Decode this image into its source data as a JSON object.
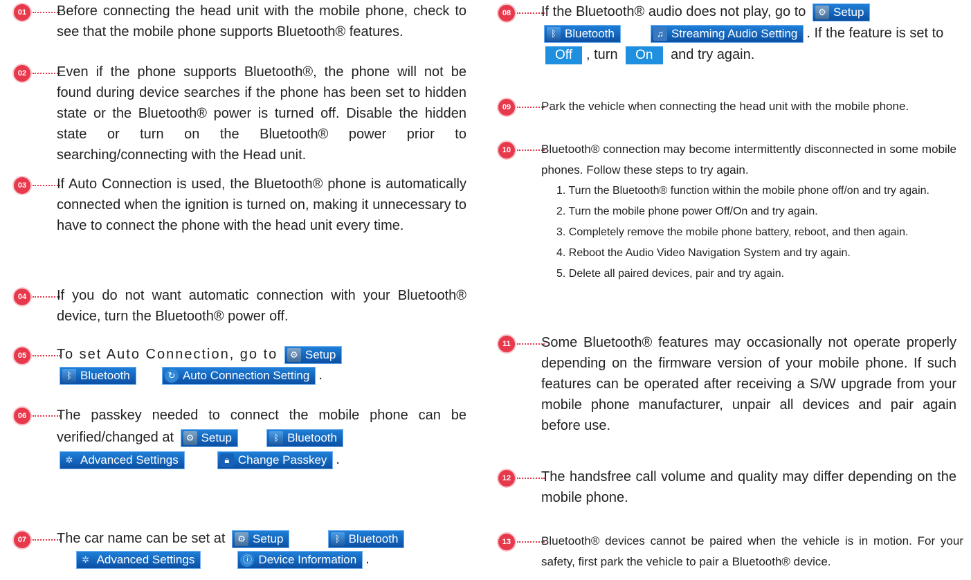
{
  "items": [
    {
      "num": "01",
      "text": "Before connecting the head unit with the mobile phone, check to see that the mobile phone supports Bluetooth® features."
    },
    {
      "num": "02",
      "text": "Even if the phone supports Bluetooth®, the phone will not be found during device searches if the phone has been set to hidden state or the Bluetooth® power is turned off. Disable the hidden state or turn on the Bluetooth® power prior to searching/connecting with the Head unit."
    },
    {
      "num": "03",
      "text": "If Auto Connection is used, the Bluetooth® phone is automatically connected when the ignition is turned on, making it unnecessary to have to connect the phone with the head unit every time."
    },
    {
      "num": "04",
      "text": "If you do not want automatic connection with your Bluetooth® device, turn the Bluetooth® power off."
    },
    {
      "num": "05",
      "text": "To set Auto Connection, go to",
      "buttons": [
        "Setup",
        "Bluetooth",
        "Auto Connection Setting"
      ],
      "end": "."
    },
    {
      "num": "06",
      "text": "The passkey needed to connect the mobile phone can be verified/changed at",
      "buttons": [
        "Setup",
        "Bluetooth",
        "Advanced Settings",
        "Change Passkey"
      ],
      "end": "."
    },
    {
      "num": "07",
      "text": "The car name can be set at",
      "buttons": [
        "Setup",
        "Bluetooth",
        "Advanced Settings",
        "Device Information"
      ],
      "end": "."
    },
    {
      "num": "08",
      "text_a": "If the Bluetooth® audio does not play, go to",
      "buttons": [
        "Setup",
        "Bluetooth",
        "Streaming Audio Setting"
      ],
      "text_b": ". If the feature is set to",
      "chip_off": "Off",
      "text_c": ", turn",
      "chip_on": "On",
      "text_d": "and try again."
    },
    {
      "num": "09",
      "text": "Park the vehicle when connecting the head unit with the mobile phone."
    },
    {
      "num": "10",
      "text": "Bluetooth® connection may become intermittently disconnected in some mobile phones. Follow these steps to try again.",
      "steps": [
        "1. Turn the Bluetooth® function within the mobile phone off/on and try again.",
        "2. Turn the mobile phone power Off/On and try again.",
        "3. Completely remove the mobile phone battery, reboot, and then again.",
        "4. Reboot the Audio Video Navigation System and try again.",
        "5. Delete all paired devices, pair and try again."
      ]
    },
    {
      "num": "11",
      "text": "Some Bluetooth® features may occasionally not operate properly depending on the firmware version of your mobile phone. If such features can be operated after receiving a S/W upgrade from your mobile phone manufacturer, unpair all devices and pair again before use."
    },
    {
      "num": "12",
      "text": "The handsfree call volume and quality may differ depending on the mobile phone."
    },
    {
      "num": "13",
      "text": "Bluetooth® devices cannot be paired when the vehicle is in motion. For your safety, first park the vehicle to pair a Bluetooth® device."
    }
  ],
  "icons": {
    "setup": "setup-icon",
    "bluetooth": "bluetooth-icon",
    "auto": "auto-connection-icon",
    "advanced": "advanced-settings-icon",
    "passkey": "lock-icon",
    "device": "device-info-icon",
    "stream": "music-note-icon"
  },
  "colors": {
    "badge": "#e8384b",
    "button": "#0b4fa3",
    "chip": "#1f8fe0"
  }
}
